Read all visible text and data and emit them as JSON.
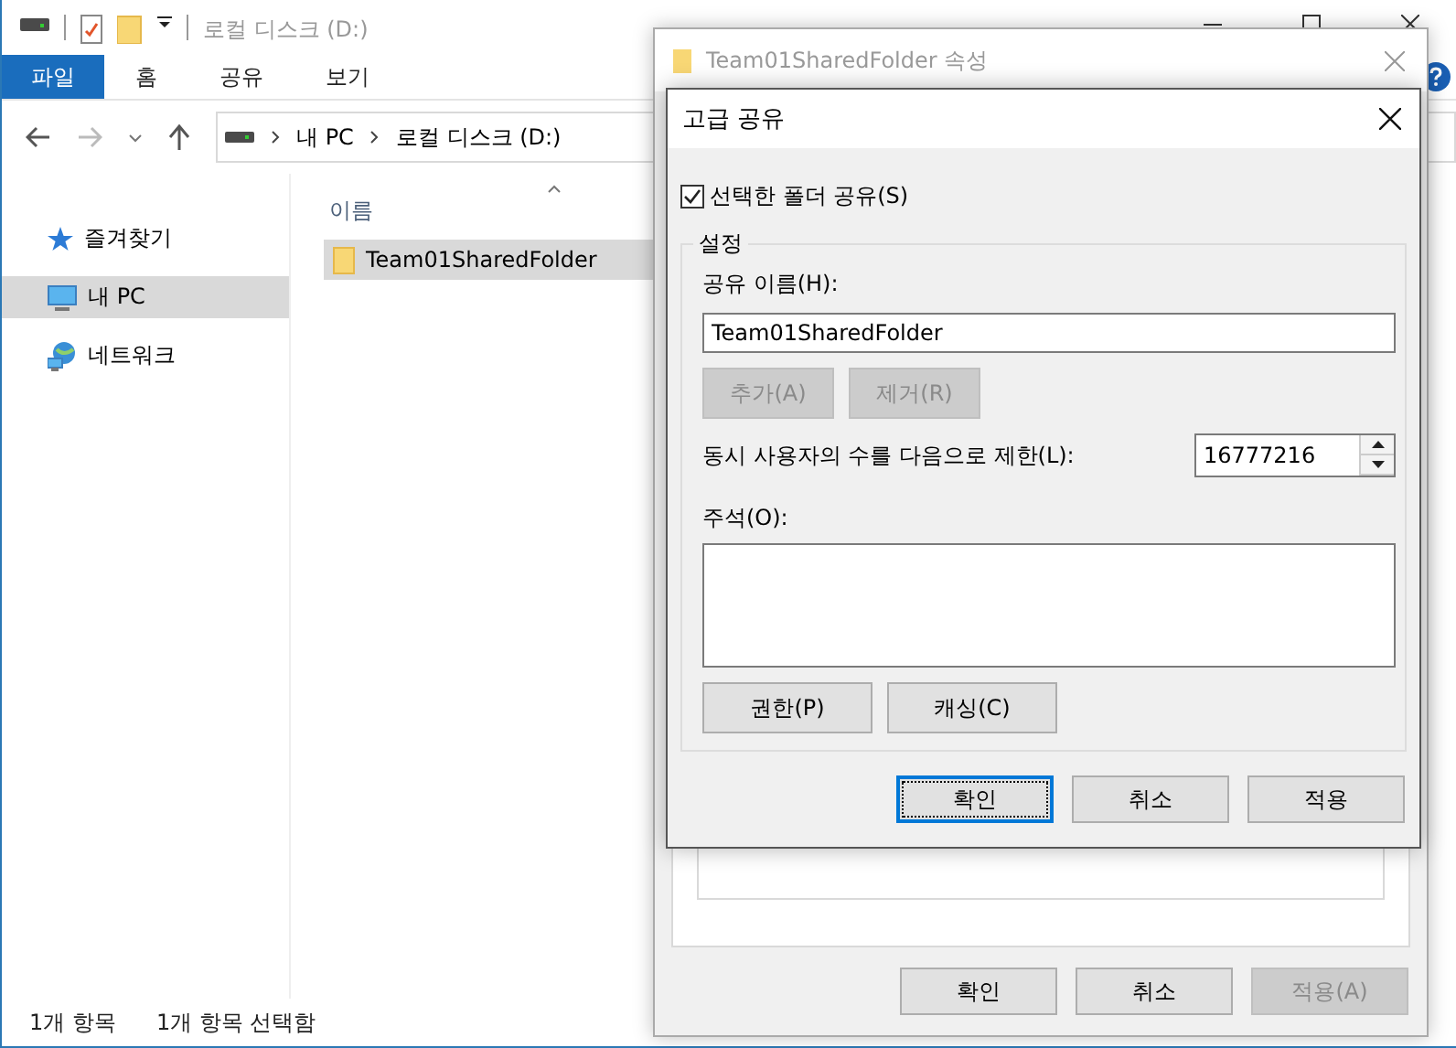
{
  "explorer": {
    "title": "로컬 디스크 (D:)",
    "ribbon_tabs": [
      {
        "label": "파일",
        "selected": true
      },
      {
        "label": "홈",
        "selected": false
      },
      {
        "label": "공유",
        "selected": false
      },
      {
        "label": "보기",
        "selected": false
      }
    ],
    "breadcrumb": [
      "내 PC",
      "로컬 디스크 (D:)"
    ],
    "nav_items": [
      {
        "label": "즐겨찾기",
        "kind": "star",
        "selected": false
      },
      {
        "label": "내 PC",
        "kind": "pc",
        "selected": true
      },
      {
        "label": "네트워크",
        "kind": "network",
        "selected": false
      }
    ],
    "column_header": "이름",
    "files": [
      {
        "name": "Team01SharedFolder",
        "selected": true
      }
    ],
    "status_bar": [
      "1개 항목",
      "1개 항목 선택함"
    ]
  },
  "properties_dialog": {
    "title": "Team01SharedFolder 속성",
    "buttons": [
      {
        "label": "확인",
        "disabled": false
      },
      {
        "label": "취소",
        "disabled": false
      },
      {
        "label": "적용(A)",
        "disabled": true
      }
    ]
  },
  "advanced_sharing": {
    "title": "고급 공유",
    "share_checkbox": {
      "label": "선택한 폴더 공유(S)",
      "checked": true
    },
    "group_title": "설정",
    "share_name_label": "공유 이름(H):",
    "share_name_value": "Team01SharedFolder",
    "name_buttons": [
      {
        "label": "추가(A)",
        "disabled": true
      },
      {
        "label": "제거(R)",
        "disabled": true
      }
    ],
    "user_limit_label": "동시 사용자의 수를 다음으로 제한(L):",
    "user_limit_value": "16777216",
    "comment_label": "주석(O):",
    "action_buttons": [
      {
        "label": "권한(P)",
        "disabled": false
      },
      {
        "label": "캐싱(C)",
        "disabled": false
      }
    ],
    "buttons": [
      {
        "label": "확인",
        "disabled": false,
        "focused": true
      },
      {
        "label": "취소",
        "disabled": false,
        "focused": false
      },
      {
        "label": "적용",
        "disabled": false,
        "focused": false
      }
    ]
  }
}
